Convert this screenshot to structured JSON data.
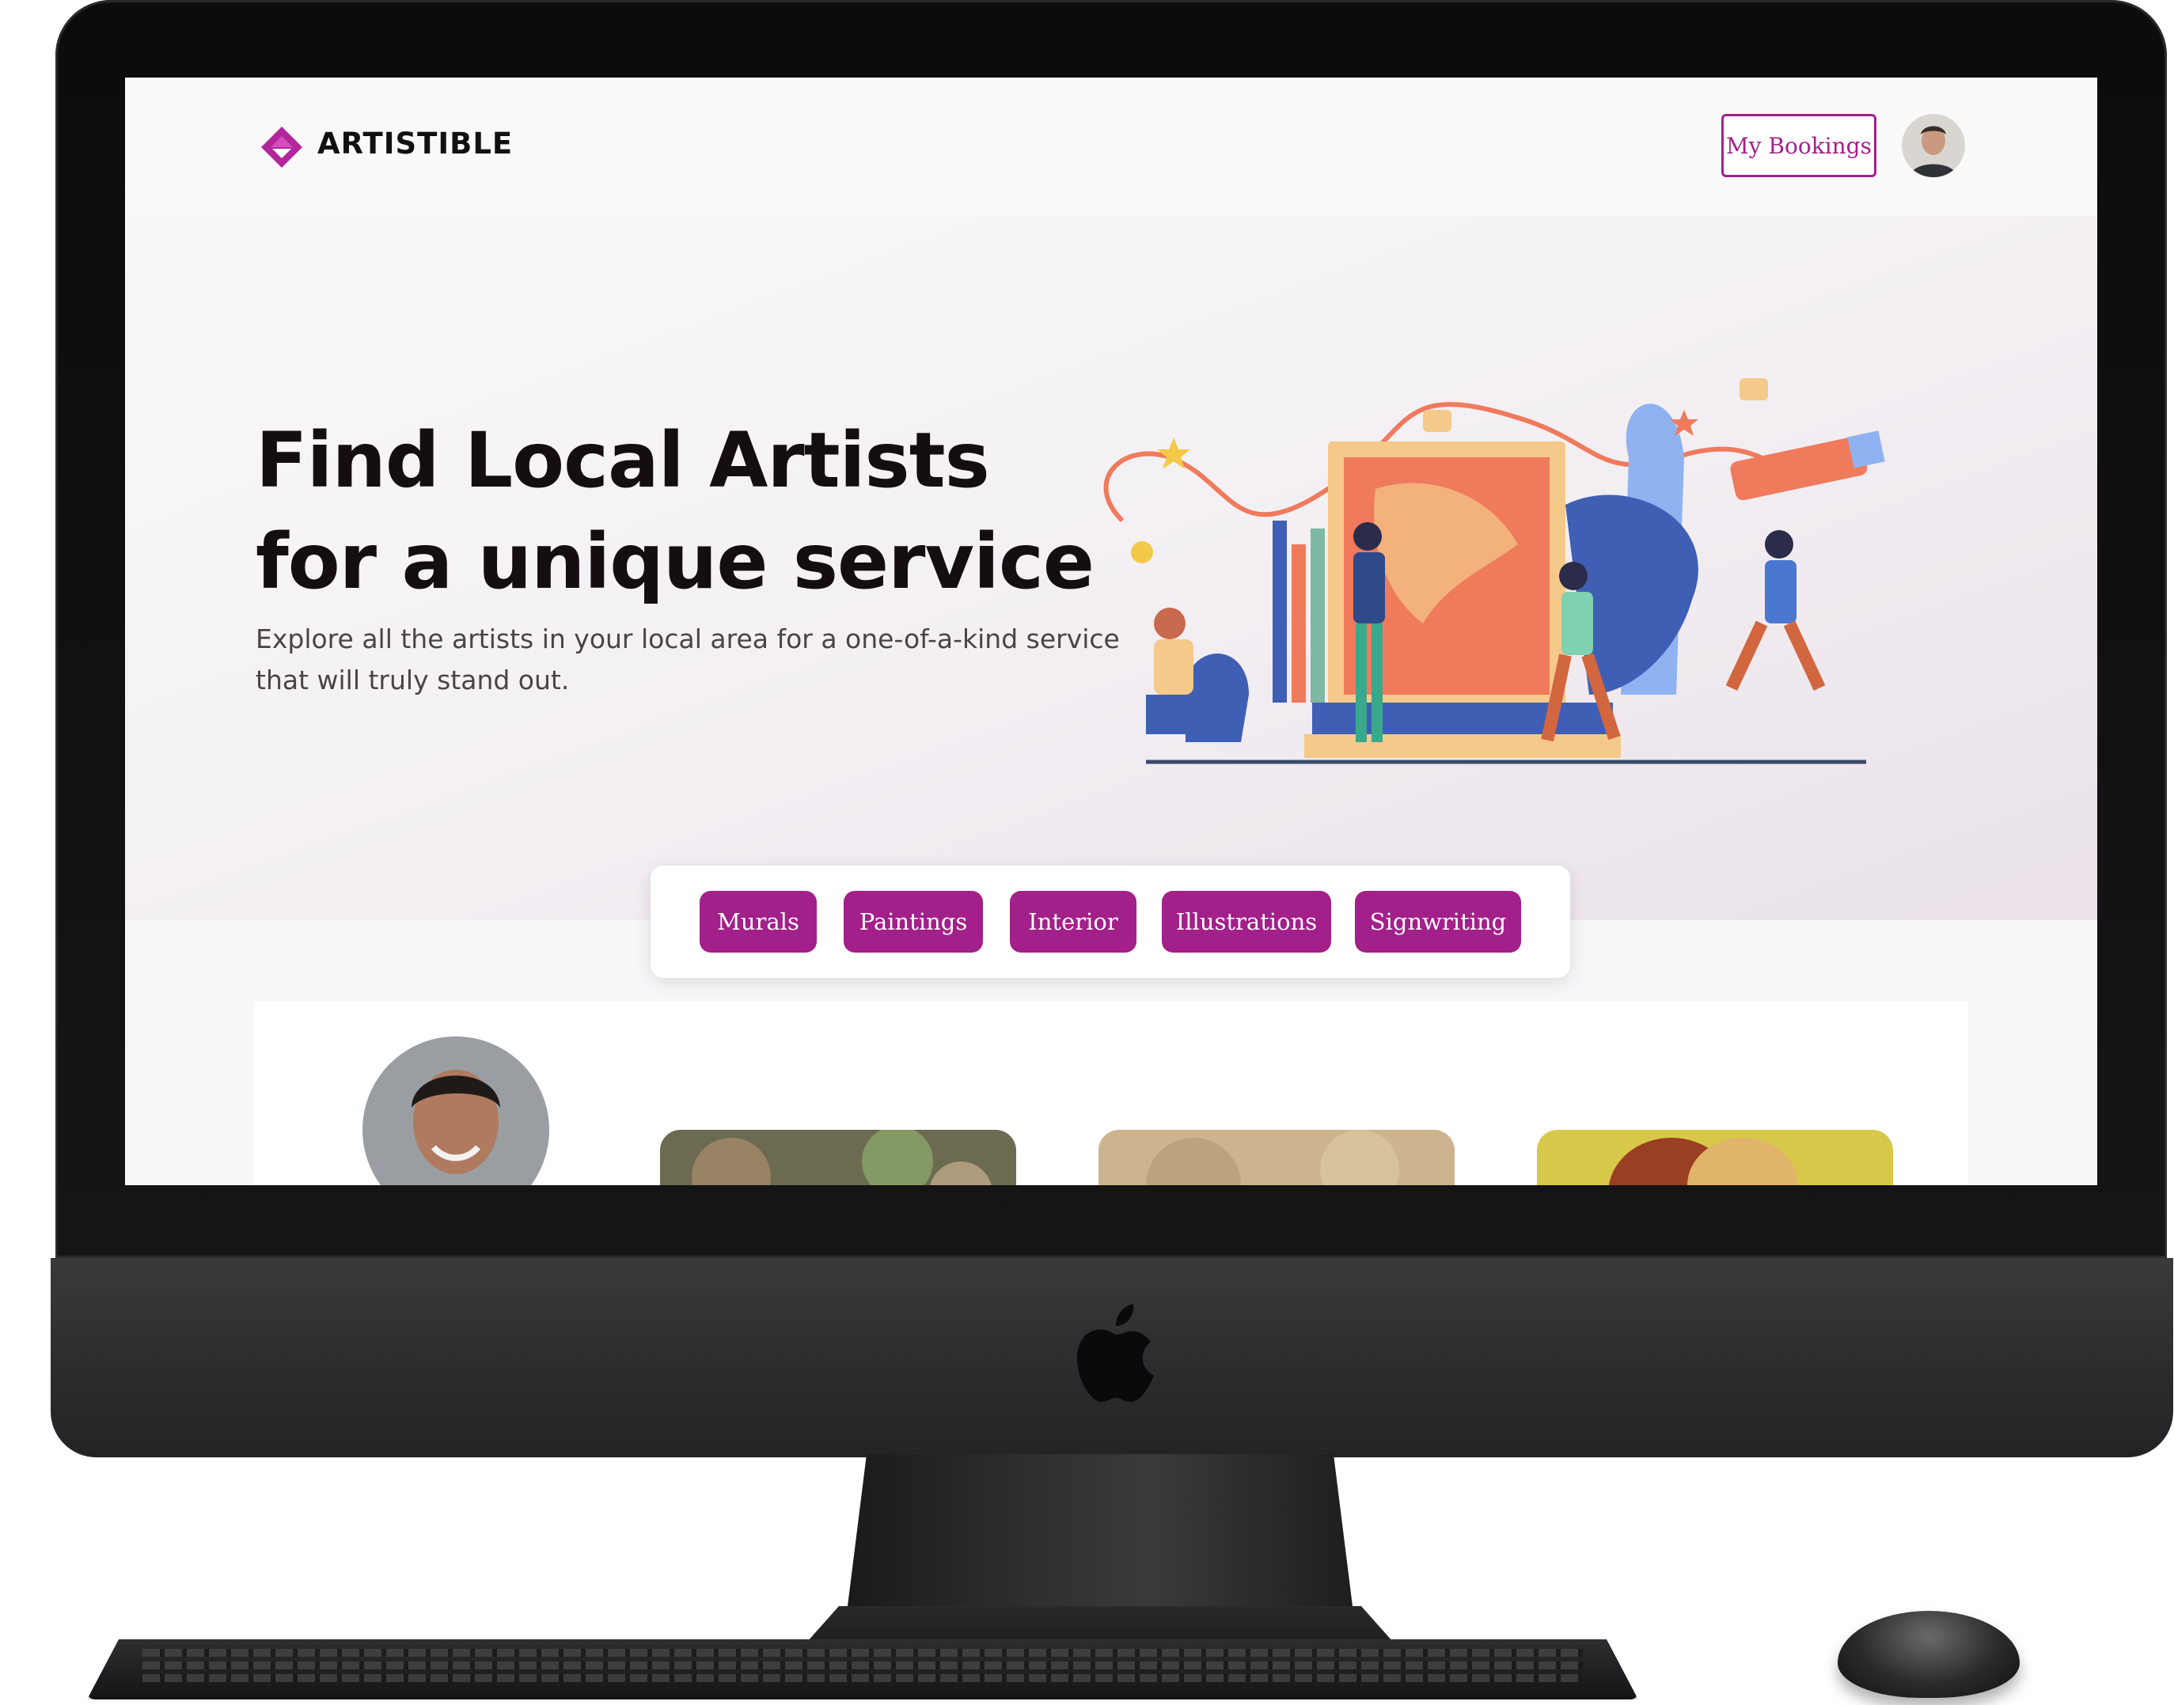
{
  "brand": {
    "name": "ARTISTIBLE",
    "accent_color": "#a31f8a"
  },
  "navbar": {
    "my_bookings_label": "My Bookings",
    "avatar_icon": "user-avatar"
  },
  "hero": {
    "headline_line1": "Find Local Artists",
    "headline_line2": "for a unique service",
    "subtext_line1": "Explore all the artists in your local area for a one-of-a-kind service",
    "subtext_line2": "that will truly stand out."
  },
  "categories": [
    {
      "label": "Murals"
    },
    {
      "label": "Paintings"
    },
    {
      "label": "Interior"
    },
    {
      "label": "Illustrations"
    },
    {
      "label": "Signwriting"
    }
  ],
  "featured": {
    "artist_photo_icon": "artist-avatar",
    "artworks": [
      "artwork-thumbnail-1",
      "artwork-thumbnail-2",
      "artwork-thumbnail-3"
    ]
  }
}
